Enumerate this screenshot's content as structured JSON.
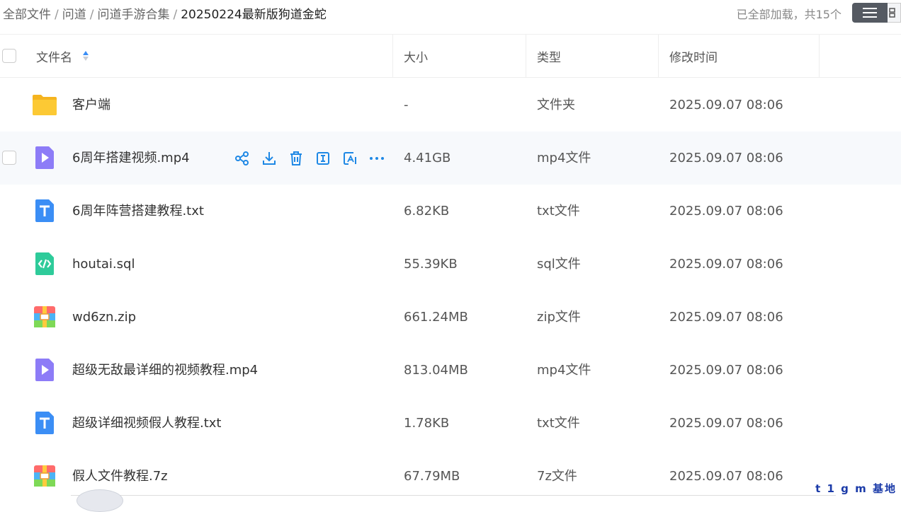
{
  "breadcrumb": {
    "items": [
      "全部文件",
      "问道",
      "问道手游合集"
    ],
    "current": "20250224最新版狗道金蛇",
    "separator": "/"
  },
  "status": {
    "loaded_text": "已全部加载，共15个"
  },
  "columns": {
    "name": "文件名",
    "size": "大小",
    "type": "类型",
    "modified": "修改时间"
  },
  "files": [
    {
      "name": "客户端",
      "size": "-",
      "type": "文件夹",
      "modified": "2025.09.07 08:06",
      "icon": "folder-icon"
    },
    {
      "name": "6周年搭建视频.mp4",
      "size": "4.41GB",
      "type": "mp4文件",
      "modified": "2025.09.07 08:06",
      "icon": "video-file-icon"
    },
    {
      "name": "6周年阵营搭建教程.txt",
      "size": "6.82KB",
      "type": "txt文件",
      "modified": "2025.09.07 08:06",
      "icon": "text-file-icon"
    },
    {
      "name": "houtai.sql",
      "size": "55.39KB",
      "type": "sql文件",
      "modified": "2025.09.07 08:06",
      "icon": "code-file-icon"
    },
    {
      "name": "wd6zn.zip",
      "size": "661.24MB",
      "type": "zip文件",
      "modified": "2025.09.07 08:06",
      "icon": "archive-file-icon"
    },
    {
      "name": "超级无敌最详细的视频教程.mp4",
      "size": "813.04MB",
      "type": "mp4文件",
      "modified": "2025.09.07 08:06",
      "icon": "video-file-icon"
    },
    {
      "name": "超级详细视频假人教程.txt",
      "size": "1.78KB",
      "type": "txt文件",
      "modified": "2025.09.07 08:06",
      "icon": "text-file-icon"
    },
    {
      "name": "假人文件教程.7z",
      "size": "67.79MB",
      "type": "7z文件",
      "modified": "2025.09.07 08:06",
      "icon": "archive-file-icon"
    }
  ],
  "row_actions": [
    "share-icon",
    "download-icon",
    "delete-icon",
    "rename-icon",
    "ai-summary-icon",
    "more-icon"
  ],
  "watermark": "t 1 g m 基地",
  "colors": {
    "accent": "#1e88e5",
    "folder": "#f9c22e",
    "video": "#8d7cf7",
    "text": "#3b8ef5",
    "code": "#2ecb9a"
  }
}
